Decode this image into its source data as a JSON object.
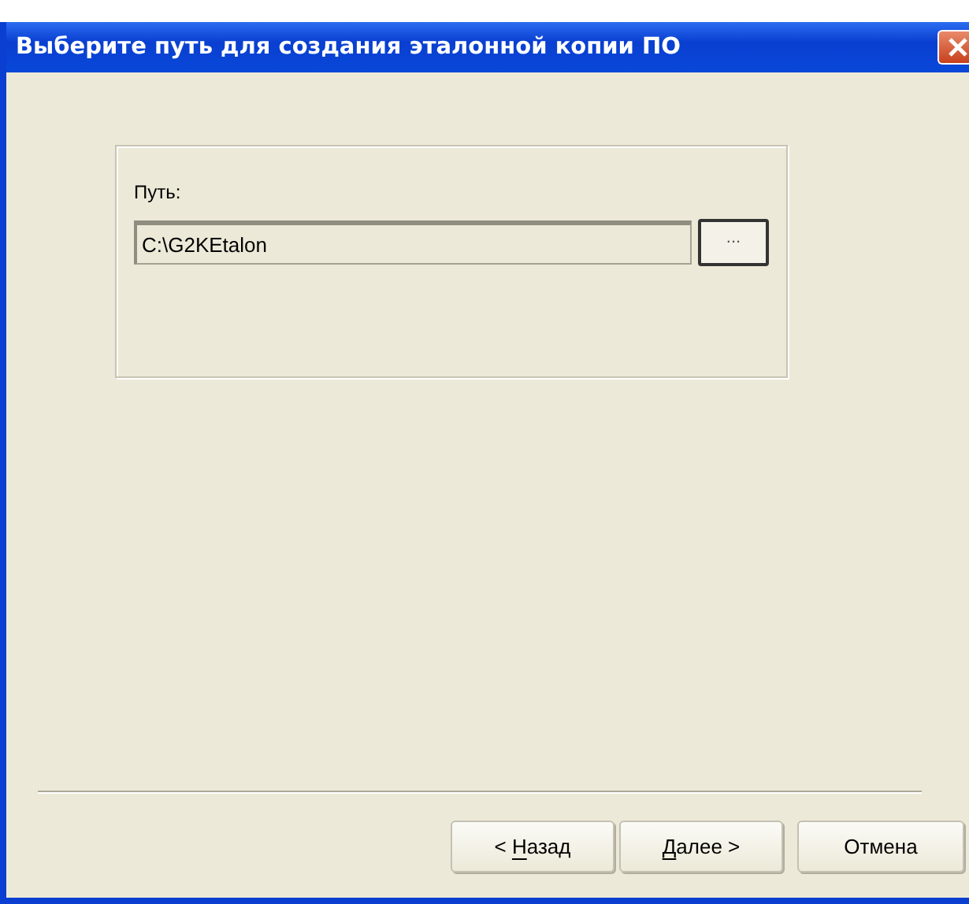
{
  "window": {
    "title": "Выберите путь для создания эталонной копии ПО"
  },
  "path_group": {
    "label": "Путь:",
    "value": "C:\\G2KEtalon",
    "browse_button": "..."
  },
  "buttons": [
    {
      "label_parts": [
        {
          "text": "< ",
          "underlined": false
        },
        {
          "text": "Н",
          "underlined": true
        },
        {
          "text": "азад",
          "underlined": false
        }
      ],
      "default": false
    },
    {
      "label_parts": [
        {
          "text": "Д",
          "underlined": true
        },
        {
          "text": "алее >",
          "underlined": false
        }
      ],
      "default": false
    },
    {
      "label_parts": [
        {
          "text": "Отмена",
          "underlined": false
        }
      ],
      "default": false
    }
  ]
}
